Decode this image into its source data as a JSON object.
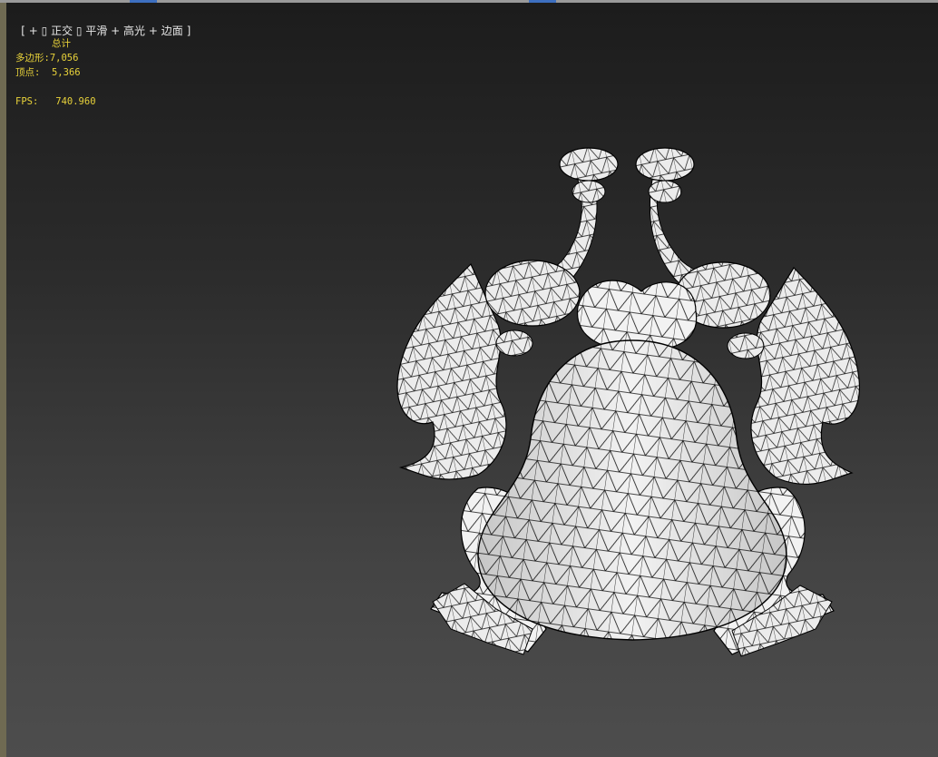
{
  "viewport": {
    "label": {
      "open": "[",
      "plus": "+",
      "view": "正交",
      "shading": "平滑",
      "highlight": "+ 高光",
      "edges": "+ 边面",
      "close": "]"
    },
    "stats": {
      "title": "总计",
      "polygons_label": "多边形:",
      "polygons_value": "7,056",
      "vertices_label": "顶点:",
      "vertices_value": "5,366",
      "fps_label": "FPS:",
      "fps_value": "740.960"
    },
    "model": {
      "name": "toad-wireframe-model",
      "shading": "white-smooth-with-edges"
    }
  },
  "colors": {
    "stats_text": "#e8d23a",
    "label_text": "#e6e6e6",
    "tab_accent": "#3d6fc0",
    "mesh_fill": "#f2f2f2",
    "mesh_edge": "#000000"
  }
}
